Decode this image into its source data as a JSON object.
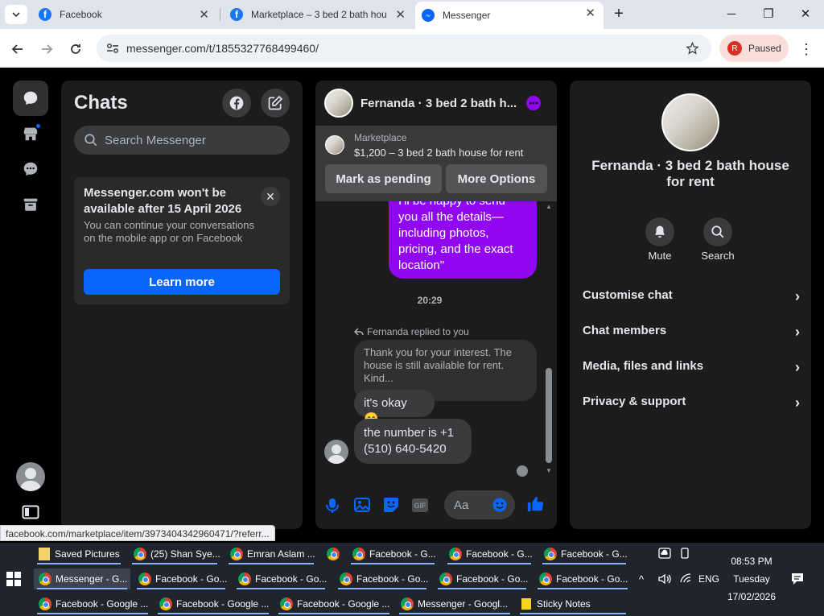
{
  "browser": {
    "tabs": [
      {
        "title": "Facebook"
      },
      {
        "title": "Marketplace – 3 bed 2 bath hou"
      },
      {
        "title": "Messenger"
      }
    ],
    "new_tab": "+",
    "window": {
      "minimize": "─",
      "restore": "❐",
      "close": "✕"
    },
    "url": "messenger.com/t/1855327768499460/",
    "profile_initial": "R",
    "profile_status": "Paused"
  },
  "chats": {
    "title": "Chats",
    "search_placeholder": "Search Messenger",
    "notice": {
      "title": "Messenger.com won't be available after 15 April 2026",
      "body": "You can continue your conversations on the mobile app or on Facebook",
      "button": "Learn more"
    }
  },
  "conversation": {
    "name": "Fernanda · 3 bed 2 bath h...",
    "marketplace_label": "Marketplace",
    "listing": "$1,200 – 3 bed 2 bath house for rent",
    "mark_pending": "Mark as pending",
    "more_options": "More Options",
    "outgoing_text": "I'll be happy to send you all the details—including photos, pricing, and the exact location\"",
    "timestamp": "20:29",
    "replied_label": "Fernanda replied to you",
    "quoted": "Thank you for your interest. The house is still available for rent. Kind...",
    "msg1": "it's okay 😊",
    "msg2": "the number is +1 (510) 640-5420",
    "composer_placeholder": "Aa",
    "gif_label": "GIF"
  },
  "details": {
    "name": "Fernanda · 3 bed 2 bath house for rent",
    "mute": "Mute",
    "search": "Search",
    "rows": [
      {
        "label": "Customise chat"
      },
      {
        "label": "Chat members"
      },
      {
        "label": "Media, files and links"
      },
      {
        "label": "Privacy & support"
      }
    ]
  },
  "status_url": "facebook.com/marketplace/item/3973404342960471/?referr...",
  "taskbar": {
    "row1": [
      "Saved Pictures",
      "(25) Shan Sye...",
      "Emran Aslam ...",
      "",
      "Facebook - G...",
      "Facebook - G...",
      "Facebook - G..."
    ],
    "row2": [
      "Messenger - G...",
      "Facebook - Go...",
      "Facebook - Go...",
      "Facebook - Go...",
      "Facebook - Go...",
      "Facebook - Go..."
    ],
    "row3": [
      "Facebook - Google ...",
      "Facebook - Google ...",
      "Facebook - Google ...",
      "Messenger - Googl...",
      "Sticky Notes"
    ],
    "lang": "ENG",
    "time": "08:53 PM",
    "day": "Tuesday",
    "date": "17/02/2026"
  },
  "colors": {
    "accent": "#0866ff",
    "outgoing": "#9108f0",
    "panel": "#1c1c1d"
  }
}
